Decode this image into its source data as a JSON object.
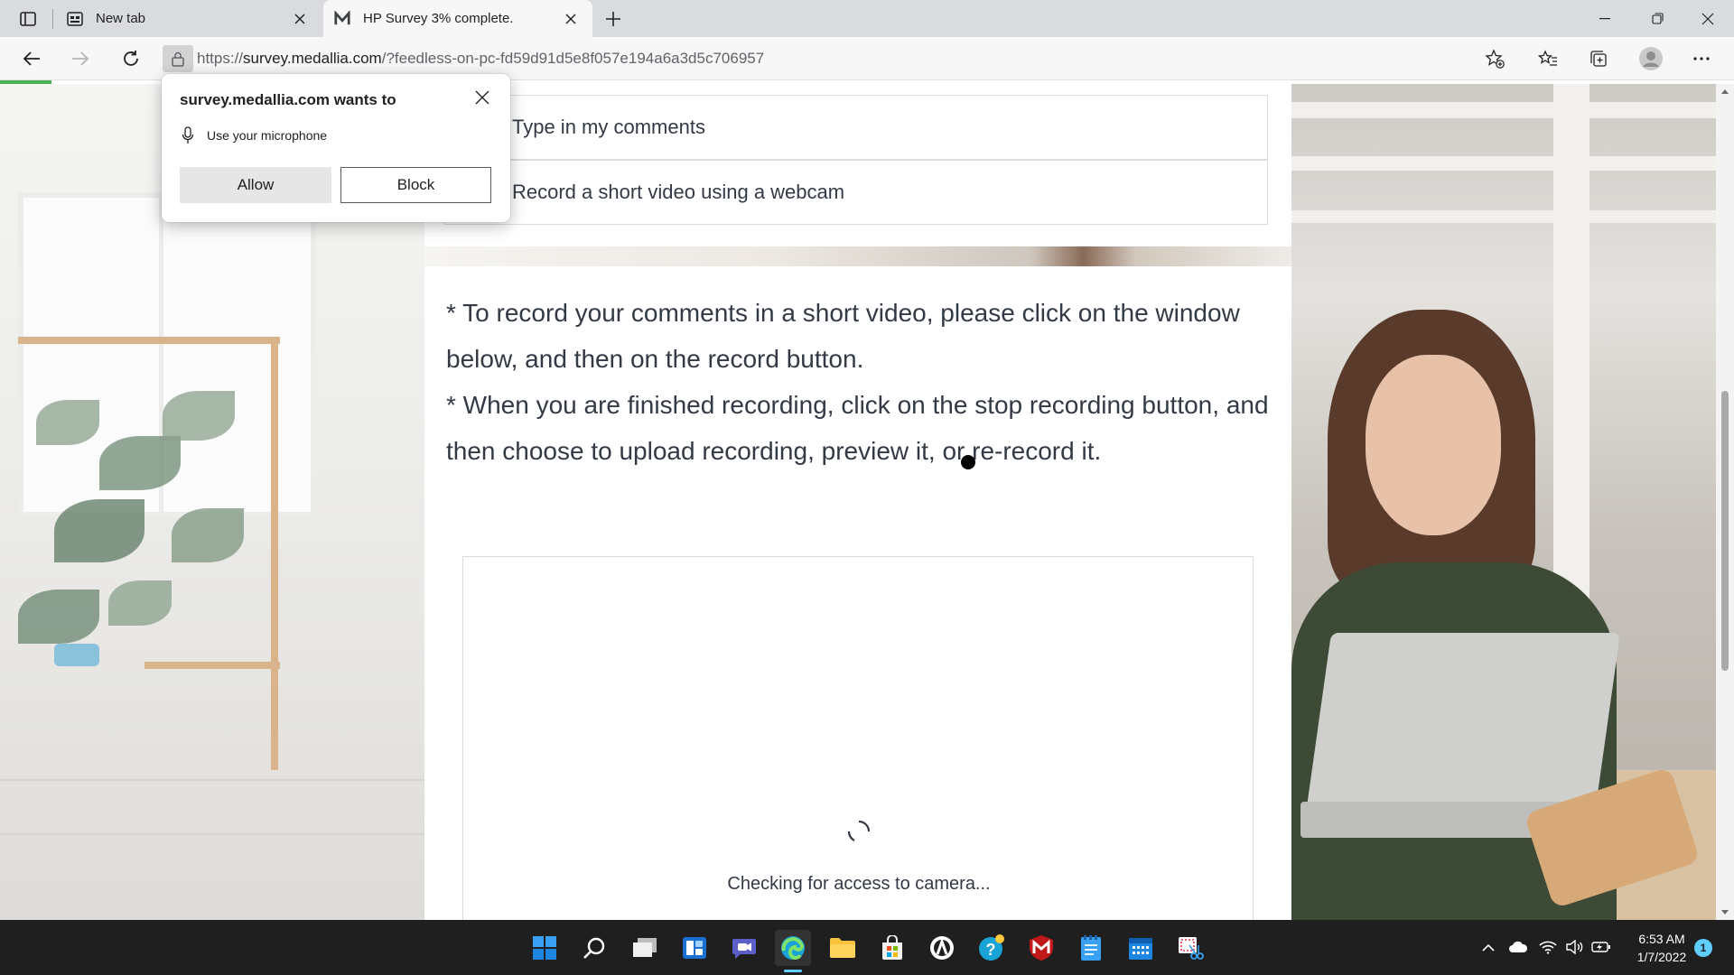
{
  "browser": {
    "tabs": [
      {
        "title": "New tab",
        "icon": "new-tab-page-icon",
        "active": false
      },
      {
        "title": "HP Survey 3% complete.",
        "icon": "medallia-m-icon",
        "active": true
      }
    ],
    "url": {
      "scheme": "https://",
      "host": "survey.medallia.com",
      "path": "/?feedless-on-pc-fd59d91d5e8f057e194a6a3d5c706957"
    },
    "load_progress": 0.03
  },
  "permission_popup": {
    "title": "survey.medallia.com wants to",
    "permission": "Use your microphone",
    "allow_label": "Allow",
    "block_label": "Block"
  },
  "survey": {
    "options": [
      "Type in my comments",
      "Record a short video using a webcam"
    ],
    "instructions": [
      "* To record your comments in a short video, please click on the window below, and then on the record button.",
      "* When you are finished recording, click on the stop recording button, and then choose to upload recording, preview it, or re-record it."
    ],
    "video_status": "Checking for access to camera..."
  },
  "taskbar": {
    "apps": [
      "start",
      "search",
      "task-view",
      "widgets",
      "teams-chat",
      "edge",
      "file-explorer",
      "microsoft-store",
      "app-circle",
      "help",
      "mcafee",
      "notepad",
      "calendar",
      "snipping-tool"
    ],
    "time": "6:53 AM",
    "date": "1/7/2022",
    "notification_count": "1"
  },
  "colors": {
    "accent_green": "#4caf50",
    "taskbar_bg": "#1f1f1f",
    "text_main": "#333a45"
  }
}
